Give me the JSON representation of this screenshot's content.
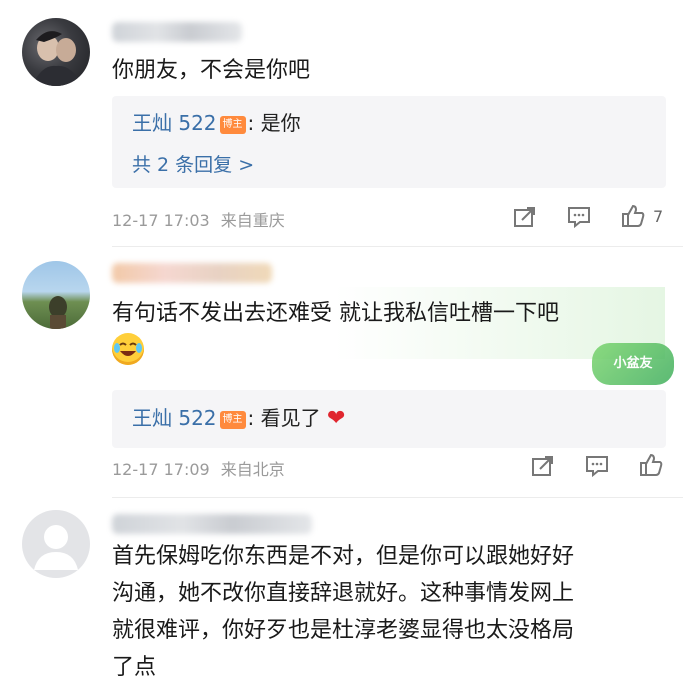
{
  "comments": [
    {
      "text": "你朋友，不会是你吧",
      "reply": {
        "user": "王灿 522",
        "badge": "博主",
        "text": ": 是你"
      },
      "more_replies": "共 2 条回复 >",
      "time": "12-17 17:03",
      "source": "来自重庆",
      "likes": "7"
    },
    {
      "text_line1": "有句话不发出去还难受 就让我私信吐槽一下吧",
      "reply": {
        "user": "王灿 522",
        "badge": "博主",
        "text": ": 看见了"
      },
      "heart": "❤",
      "time": "12-17 17:09",
      "source": "来自北京",
      "sticker": "小盆友"
    },
    {
      "lines": [
        "首先保姆吃你东西是不对，但是你可以跟她好好",
        "沟通，她不改你直接辞退就好。这种事情发网上",
        "就很难评，你好歹也是杜淳老婆显得也太没格局",
        "了点"
      ]
    }
  ],
  "icons": {
    "share": "share-icon",
    "comment": "comment-icon",
    "like": "thumbs-up-icon"
  },
  "colors": {
    "link_blue": "#3a6fa8",
    "badge_orange": "#ff8a3d",
    "meta_gray": "#9a9a9a",
    "heart_red": "#e0262f"
  }
}
